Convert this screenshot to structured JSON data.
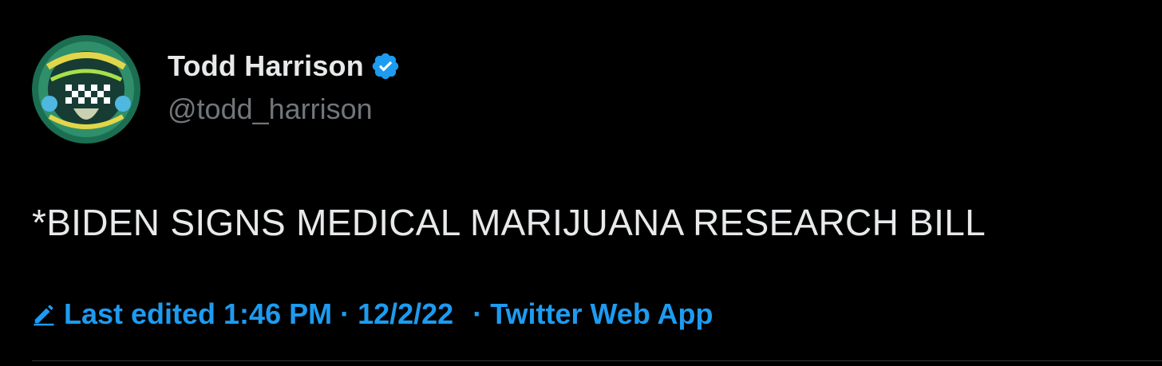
{
  "author": {
    "display_name": "Todd Harrison",
    "handle": "@todd_harrison",
    "verified": true,
    "verified_icon": "verified-badge-icon",
    "avatar_icon": "avatar-artwork"
  },
  "tweet": {
    "text": "*BIDEN SIGNS MEDICAL MARIJUANA RESEARCH BILL"
  },
  "meta": {
    "edit_icon": "pencil-icon",
    "edited_label": "Last edited 1:46 PM",
    "separator": "·",
    "date": "12/2/22",
    "source": "Twitter Web App"
  },
  "colors": {
    "background": "#000000",
    "primary_text": "#e7e9ea",
    "secondary_text": "#71767b",
    "accent": "#1d9bf0"
  }
}
